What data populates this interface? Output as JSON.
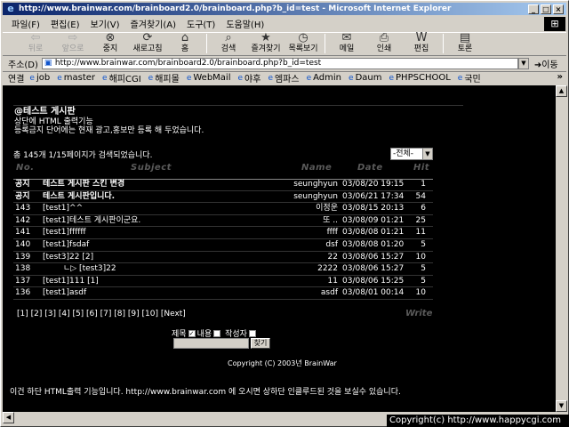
{
  "window": {
    "title": "http://www.brainwar.com/brainboard2.0/brainboard.php?b_id=test - Microsoft Internet Explorer",
    "buttons": [
      "_",
      "□",
      "×"
    ]
  },
  "menu": [
    "파일(F)",
    "편집(E)",
    "보기(V)",
    "즐겨찾기(A)",
    "도구(T)",
    "도움말(H)"
  ],
  "toolbar": [
    {
      "label": "뒤로",
      "icon": "back-icon",
      "glyph": "⇦",
      "enabled": false
    },
    {
      "label": "앞으로",
      "icon": "forward-icon",
      "glyph": "⇨",
      "enabled": false
    },
    {
      "label": "중지",
      "icon": "stop-icon",
      "glyph": "⊗",
      "enabled": true
    },
    {
      "label": "새로고침",
      "icon": "refresh-icon",
      "glyph": "⟳",
      "enabled": true
    },
    {
      "label": "홈",
      "icon": "home-icon",
      "glyph": "⌂",
      "enabled": true
    },
    {
      "label": "검색",
      "icon": "search-icon",
      "glyph": "⌕",
      "enabled": true
    },
    {
      "label": "즐겨찾기",
      "icon": "favorites-icon",
      "glyph": "★",
      "enabled": true
    },
    {
      "label": "목록보기",
      "icon": "history-icon",
      "glyph": "◷",
      "enabled": true
    },
    {
      "label": "메일",
      "icon": "mail-icon",
      "glyph": "✉",
      "enabled": true
    },
    {
      "label": "인쇄",
      "icon": "print-icon",
      "glyph": "⎙",
      "enabled": true
    },
    {
      "label": "편집",
      "icon": "edit-icon",
      "glyph": "W",
      "enabled": true
    },
    {
      "label": "토론",
      "icon": "discuss-icon",
      "glyph": "▤",
      "enabled": true
    }
  ],
  "address": {
    "label": "주소(D)",
    "url": "http://www.brainwar.com/brainboard2.0/brainboard.php?b_id=test",
    "go": "이동"
  },
  "links": {
    "label": "연결",
    "items": [
      "job",
      "master",
      "해피CGI",
      "해피몰",
      "WebMail",
      "야후",
      "엠파스",
      "Admin",
      "Daum",
      "PHPSCHOOL",
      "국민"
    ]
  },
  "board": {
    "title": "@테스트 게시판",
    "desc1": "상단에 HTML 출력기능",
    "desc2": "등록금지 단어에는 현재 광고,홍보만 등록 해 두었습니다.",
    "count": "총 145개  1/15페이지가 검색되었습니다.",
    "filter": "-전체-",
    "columns": {
      "no": "No.",
      "subject": "Subject",
      "name": "Name",
      "date": "Date",
      "hit": "Hit"
    },
    "rows": [
      {
        "no": "공지",
        "subject": "테스트 게시판 스킨 변경",
        "name": "seunghyun",
        "date": "03/08/20 19:15",
        "hit": "1",
        "notice": true
      },
      {
        "no": "공지",
        "subject": "테스트 게시판입니다.",
        "name": "seunghyun",
        "date": "03/06/21 17:34",
        "hit": "54",
        "notice": true
      },
      {
        "no": "143",
        "subject": "[test1]^^",
        "name": "이정운",
        "date": "03/08/15 20:13",
        "hit": "6",
        "notice": false
      },
      {
        "no": "142",
        "subject": "[test1]테스트 게시판이군요.",
        "name": "또 ..",
        "date": "03/08/09 01:21",
        "hit": "25",
        "notice": false
      },
      {
        "no": "141",
        "subject": "[test1]ffffff",
        "name": "ffff",
        "date": "03/08/08 01:21",
        "hit": "11",
        "notice": false
      },
      {
        "no": "140",
        "subject": "[test1]fsdaf",
        "name": "dsf",
        "date": "03/08/08 01:20",
        "hit": "5",
        "notice": false
      },
      {
        "no": "139",
        "subject": "[test3]22 [2]",
        "name": "22",
        "date": "03/08/06 15:27",
        "hit": "10",
        "notice": false
      },
      {
        "no": "138",
        "subject": "ㄴ▷ [test3]22",
        "name": "2222",
        "date": "03/08/06 15:27",
        "hit": "5",
        "notice": false
      },
      {
        "no": "137",
        "subject": "[test1]111 [1]",
        "name": "11",
        "date": "03/08/06 15:25",
        "hit": "5",
        "notice": false
      },
      {
        "no": "136",
        "subject": "[test1]asdf",
        "name": "asdf",
        "date": "03/08/01 00:14",
        "hit": "10",
        "notice": false
      }
    ],
    "pager": "[1] [2] [3] [4] [5] [6] [7] [8] [9] [10]  [Next]",
    "write": "Write",
    "search": {
      "subject": "제목",
      "content": "내용",
      "author": "작성자",
      "button": "찾기"
    },
    "copyright": "Copyright (C) 2003년 BrainWar"
  },
  "footer": "이건 하단 HTML출력 기능입니다. http://www.brainwar.com 에 오시면 상하단 인클루드된 것을 보실수 있습니다.",
  "status": "Copyright(c) http://www.happycgi.com"
}
